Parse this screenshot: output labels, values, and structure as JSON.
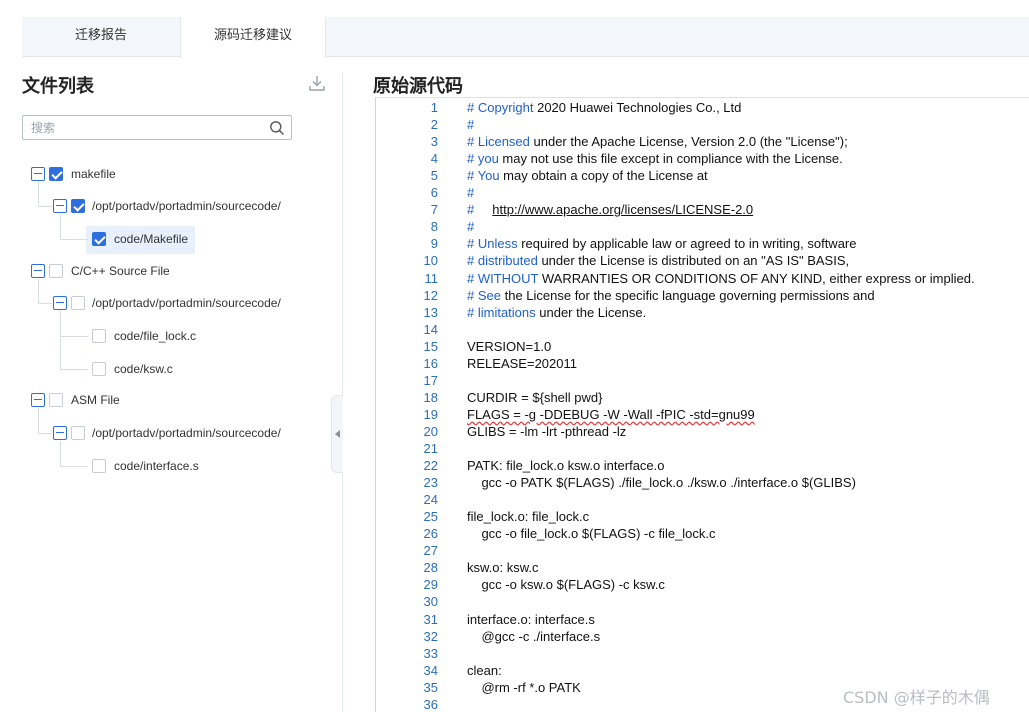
{
  "tabs": [
    {
      "label": "迁移报告"
    },
    {
      "label": "源码迁移建议"
    }
  ],
  "file_list": {
    "title": "文件列表",
    "download_icon": "download-icon",
    "search_placeholder": "搜索",
    "tree": [
      {
        "label": "makefile",
        "checked": true
      },
      {
        "label": "/opt/portadv/portadmin/sourcecode/",
        "checked": true
      },
      {
        "label": "code/Makefile",
        "checked": true,
        "selected": true
      },
      {
        "label": "C/C++ Source File",
        "checked": false
      },
      {
        "label": "/opt/portadv/portadmin/sourcecode/",
        "checked": false
      },
      {
        "label": "code/file_lock.c",
        "checked": false
      },
      {
        "label": "code/ksw.c",
        "checked": false
      },
      {
        "label": "ASM File",
        "checked": false
      },
      {
        "label": "/opt/portadv/portadmin/sourcecode/",
        "checked": false
      },
      {
        "label": "code/interface.s",
        "checked": false
      }
    ]
  },
  "editor": {
    "title": "原始源代码",
    "lines": [
      {
        "n": "1",
        "kw": "# Copyright",
        "rest": " 2020 Huawei Technologies Co., Ltd"
      },
      {
        "n": "2",
        "kw": "#",
        "rest": ""
      },
      {
        "n": "3",
        "kw": "# Licensed",
        "rest": " under the Apache License, Version 2.0 (the \"License\");"
      },
      {
        "n": "4",
        "kw": "# you",
        "rest": " may not use this file except in compliance with the License."
      },
      {
        "n": "5",
        "kw": "# You",
        "rest": " may obtain a copy of the License at"
      },
      {
        "n": "6",
        "kw": "#",
        "rest": ""
      },
      {
        "n": "7",
        "kw": "#",
        "rest": "     ",
        "link": "http://www.apache.org/licenses/LICENSE-2.0"
      },
      {
        "n": "8",
        "kw": "#",
        "rest": ""
      },
      {
        "n": "9",
        "kw": "# Unless",
        "rest": " required by applicable law or agreed to in writing, software"
      },
      {
        "n": "10",
        "kw": "# distributed",
        "rest": " under the License is distributed on an \"AS IS\" BASIS,"
      },
      {
        "n": "11",
        "kw": "# WITHOUT",
        "rest": " WARRANTIES OR CONDITIONS OF ANY KIND, either express or implied."
      },
      {
        "n": "12",
        "kw": "# See",
        "rest": " the License for the specific language governing permissions and"
      },
      {
        "n": "13",
        "kw": "# limitations",
        "rest": " under the License."
      },
      {
        "n": "14",
        "rest": ""
      },
      {
        "n": "15",
        "rest": "VERSION=1.0"
      },
      {
        "n": "16",
        "rest": "RELEASE=202011"
      },
      {
        "n": "17",
        "rest": ""
      },
      {
        "n": "18",
        "rest": "CURDIR = ${shell pwd}"
      },
      {
        "n": "19",
        "rest": "FLAGS = -g -DDEBUG -W -Wall -fPIC -std=gnu99",
        "warn": true
      },
      {
        "n": "20",
        "rest": "GLIBS = -lm -lrt -pthread -lz"
      },
      {
        "n": "21",
        "rest": ""
      },
      {
        "n": "22",
        "rest": "PATK: file_lock.o ksw.o interface.o"
      },
      {
        "n": "23",
        "rest": "    gcc -o PATK $(FLAGS) ./file_lock.o ./ksw.o ./interface.o $(GLIBS)"
      },
      {
        "n": "24",
        "rest": ""
      },
      {
        "n": "25",
        "rest": "file_lock.o: file_lock.c"
      },
      {
        "n": "26",
        "rest": "    gcc -o file_lock.o $(FLAGS) -c file_lock.c"
      },
      {
        "n": "27",
        "rest": ""
      },
      {
        "n": "28",
        "rest": "ksw.o: ksw.c"
      },
      {
        "n": "29",
        "rest": "    gcc -o ksw.o $(FLAGS) -c ksw.c"
      },
      {
        "n": "30",
        "rest": ""
      },
      {
        "n": "31",
        "rest": "interface.o: interface.s"
      },
      {
        "n": "32",
        "rest": "    @gcc -c ./interface.s"
      },
      {
        "n": "33",
        "rest": ""
      },
      {
        "n": "34",
        "rest": "clean:"
      },
      {
        "n": "35",
        "rest": "    @rm -rf *.o PATK"
      },
      {
        "n": "36",
        "rest": ""
      }
    ]
  },
  "watermark": "CSDN @样子的木偶",
  "colors": {
    "accent": "#2d6ee0",
    "comment_keyword": "#1f5fcf",
    "line_number": "#2a6fb7"
  }
}
